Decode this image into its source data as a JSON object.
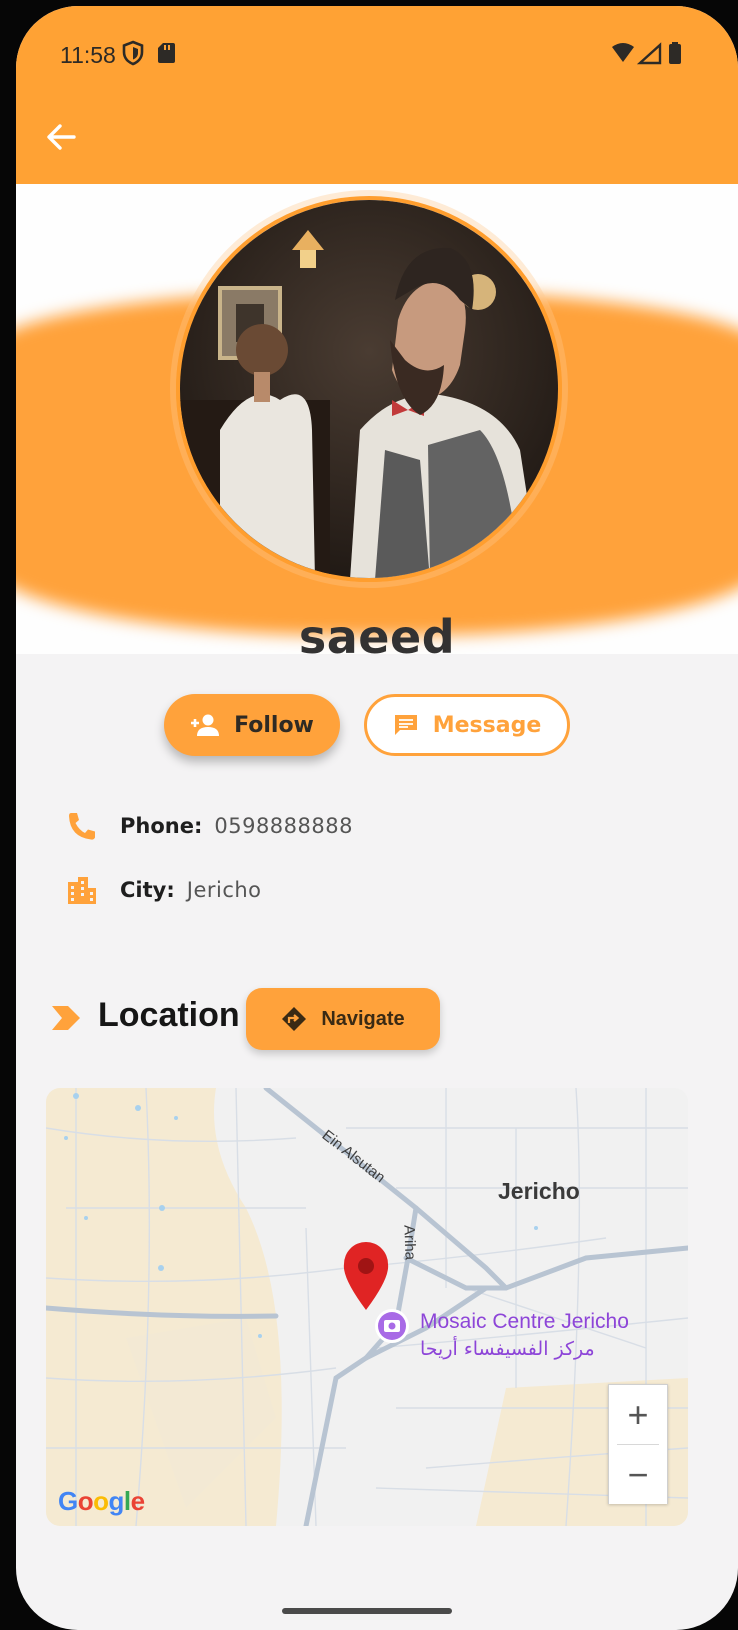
{
  "status_bar": {
    "time": "11:58",
    "icons": [
      "shield-icon",
      "sd-card-icon",
      "wifi-icon",
      "signal-icon",
      "battery-icon"
    ]
  },
  "app_bar": {
    "back_icon": "arrow-left-icon"
  },
  "colors": {
    "accent": "#ffa23b",
    "background": "#f4f3f4",
    "poi": "#8d45d8",
    "pin": "#e02424"
  },
  "profile": {
    "name": "saeed",
    "avatar": "bearded man in barbershop"
  },
  "actions": {
    "follow_label": "Follow",
    "follow_icon": "person-add-icon",
    "message_label": "Message",
    "message_icon": "chat-icon"
  },
  "info": {
    "phone_label": "Phone:",
    "phone_value": "0598888888",
    "phone_icon": "phone-icon",
    "city_label": "City:",
    "city_value": "Jericho",
    "city_icon": "building-icon"
  },
  "location": {
    "title": "Location",
    "navigate_label": "Navigate",
    "navigate_icon": "directions-icon"
  },
  "map": {
    "city_label": "Jericho",
    "road_1": "Ein Alsutan",
    "road_2": "Ariha",
    "poi_name_en": "Mosaic Centre Jericho",
    "poi_name_ar": "مركز الفسيفساء أريحا",
    "attribution": "Google",
    "zoom_in": "+",
    "zoom_out": "−"
  }
}
